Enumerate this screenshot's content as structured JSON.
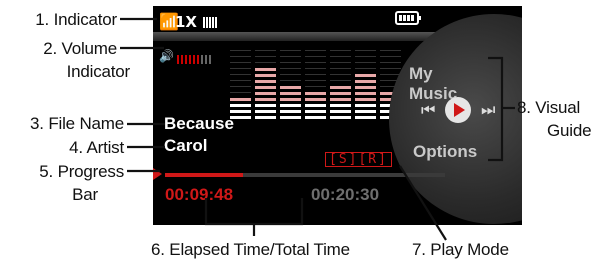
{
  "callouts": {
    "c1": "1. Indicator",
    "c2a": "2. Volume",
    "c2b": "Indicator",
    "c3": "3. File Name",
    "c4": "4. Artist",
    "c5a": "5. Progress",
    "c5b": "Bar",
    "c6": "6. Elapsed Time/Total Time",
    "c7": "7. Play Mode",
    "c8a": "8. Visual",
    "c8b": "Guide"
  },
  "status": {
    "network": "1X",
    "signal_icon": "antenna-icon",
    "battery_icon": "battery-icon"
  },
  "volume": {
    "level": 6,
    "max": 9
  },
  "equalizer": {
    "column_levels": [
      4,
      9,
      6,
      5,
      6,
      8,
      5
    ]
  },
  "track": {
    "title": "Because",
    "artist": "Carol"
  },
  "play_mode": "[S][R]",
  "progress": {
    "fraction": 0.28
  },
  "time": {
    "elapsed": "00:09:48",
    "total": "00:20:30"
  },
  "controls": {
    "my_music": "My Music",
    "options": "Options",
    "prev_icon": "skip-back-icon",
    "play_icon": "play-icon",
    "next_icon": "skip-forward-icon"
  },
  "colors": {
    "accent": "#d01818",
    "eq_active": "#e8a8a8",
    "eq_idle": "#ffffff"
  }
}
